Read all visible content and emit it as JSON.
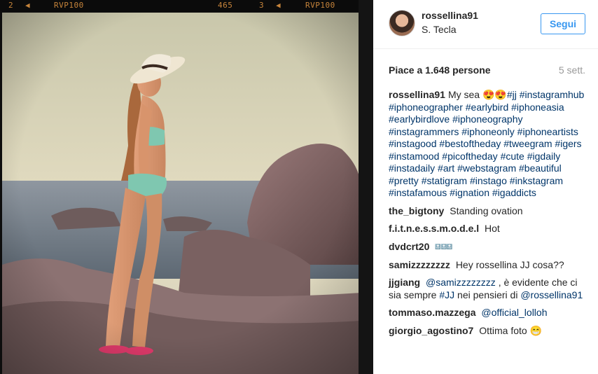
{
  "film_strip": {
    "left_number": "2",
    "left_label": "RVP100",
    "middle_number": "465",
    "right_number": "3",
    "right_label": "RVP100"
  },
  "post": {
    "username": "rossellina91",
    "location": "S. Tecla",
    "follow_label": "Segui",
    "likes_label": "Piace a 1.648 persone",
    "time_ago": "5 sett."
  },
  "caption": {
    "username": "rossellina91",
    "text": "My sea",
    "emoji": "😍😍",
    "hashtags": [
      "#jj",
      "#instagramhub",
      "#iphoneographer",
      "#earlybird",
      "#iphoneasia",
      "#earlybirdlove",
      "#iphoneography",
      "#instagrammers",
      "#iphoneonly",
      "#iphoneartists",
      "#instagood",
      "#bestoftheday",
      "#tweegram",
      "#igers",
      "#instamood",
      "#picoftheday",
      "#cute",
      "#igdaily",
      "#instadaily",
      "#art",
      "#webstagram",
      "#beautiful",
      "#pretty",
      "#statigram",
      "#instago",
      "#inkstagram",
      "#instafamous",
      "#ignation",
      "#igaddicts"
    ]
  },
  "comments": [
    {
      "username": "the_bigtony",
      "text": "Standing ovation"
    },
    {
      "username": "f.i.t.n.e.s.s.m.o.d.e.l",
      "text": "Hot"
    },
    {
      "username": "dvdcrt20",
      "text": "🔝🔝🔝"
    },
    {
      "username": "samizzzzzzzz",
      "text": "Hey rossellina JJ cosa??"
    },
    {
      "username": "jjgiang",
      "mention": "@samizzzzzzzz",
      "text_a": ", è evidente che ci sia sempre",
      "tag": "#JJ",
      "text_b": "nei pensieri di",
      "mention2": "@rossellina91"
    },
    {
      "username": "tommaso.mazzega",
      "mention": "@official_lolloh"
    },
    {
      "username": "giorgio_agostino7",
      "text": "Ottima foto 😁"
    }
  ],
  "colors": {
    "accent": "#3897f0",
    "hashtag": "#003569",
    "film_text": "#c6843b"
  }
}
